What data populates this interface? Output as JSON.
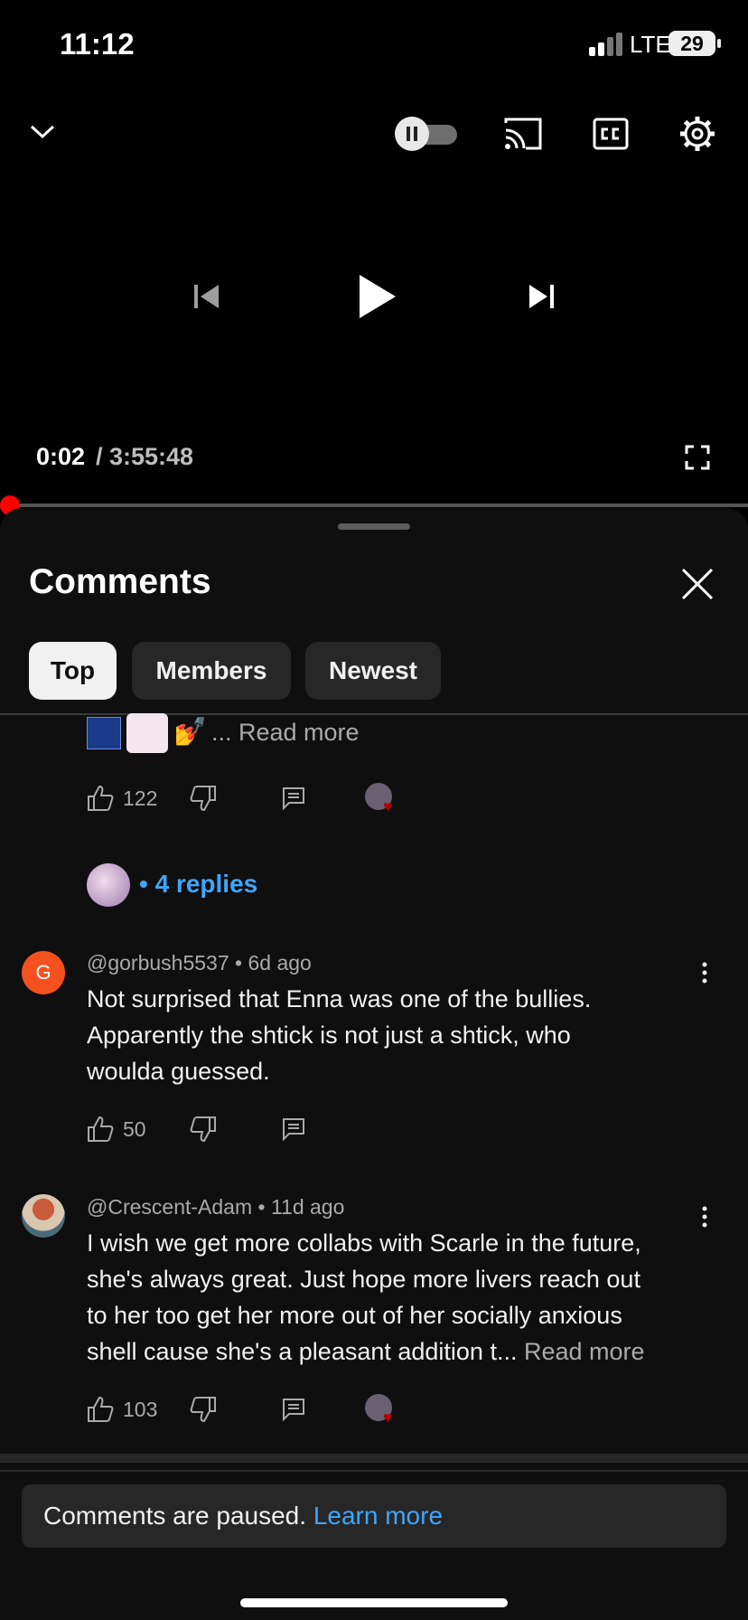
{
  "status_bar": {
    "time": "11:12",
    "network": "LTE",
    "battery": "29"
  },
  "player": {
    "current_time": "0:02",
    "total_time": "/ 3:55:48",
    "progress_fraction": 0.0001,
    "icons": [
      "chevron-down-icon",
      "autoplay-toggle",
      "cast-icon",
      "cc-icon",
      "settings-icon",
      "previous-icon",
      "play-icon",
      "next-icon",
      "fullscreen-icon"
    ]
  },
  "comments_sheet": {
    "title": "Comments",
    "tabs": [
      {
        "label": "Top",
        "active": true
      },
      {
        "label": "Members",
        "active": false
      },
      {
        "label": "Newest",
        "active": false
      }
    ],
    "first_comment": {
      "truncated_suffix": "... Read more",
      "likes": "122",
      "replies_label": "• 4 replies"
    },
    "comments": [
      {
        "author": "@gorbush5537",
        "age": "• 6d ago",
        "avatar_letter": "G",
        "avatar_color": "#f4511e",
        "text_lines": [
          "Not surprised that Enna was one of the bullies.",
          "Apparently the shtick is not just a shtick, who",
          "woulda guessed."
        ],
        "likes": "50"
      },
      {
        "author": "@Crescent-Adam",
        "age": "• 11d ago",
        "text_lines": [
          "I wish we get more collabs with Scarle in the future,",
          "she's always great. Just hope more livers reach out",
          "to her too get her more out of her socially anxious",
          "shell cause she's a pleasant addition t..."
        ],
        "read_more": "Read more",
        "likes": "103"
      }
    ],
    "paused_notice": {
      "text": "Comments are paused.",
      "link": "Learn more"
    }
  },
  "colors": {
    "accent_blue": "#3ea6ff",
    "progress_red": "#ff0000",
    "sheet_bg": "#0f0f0f"
  }
}
